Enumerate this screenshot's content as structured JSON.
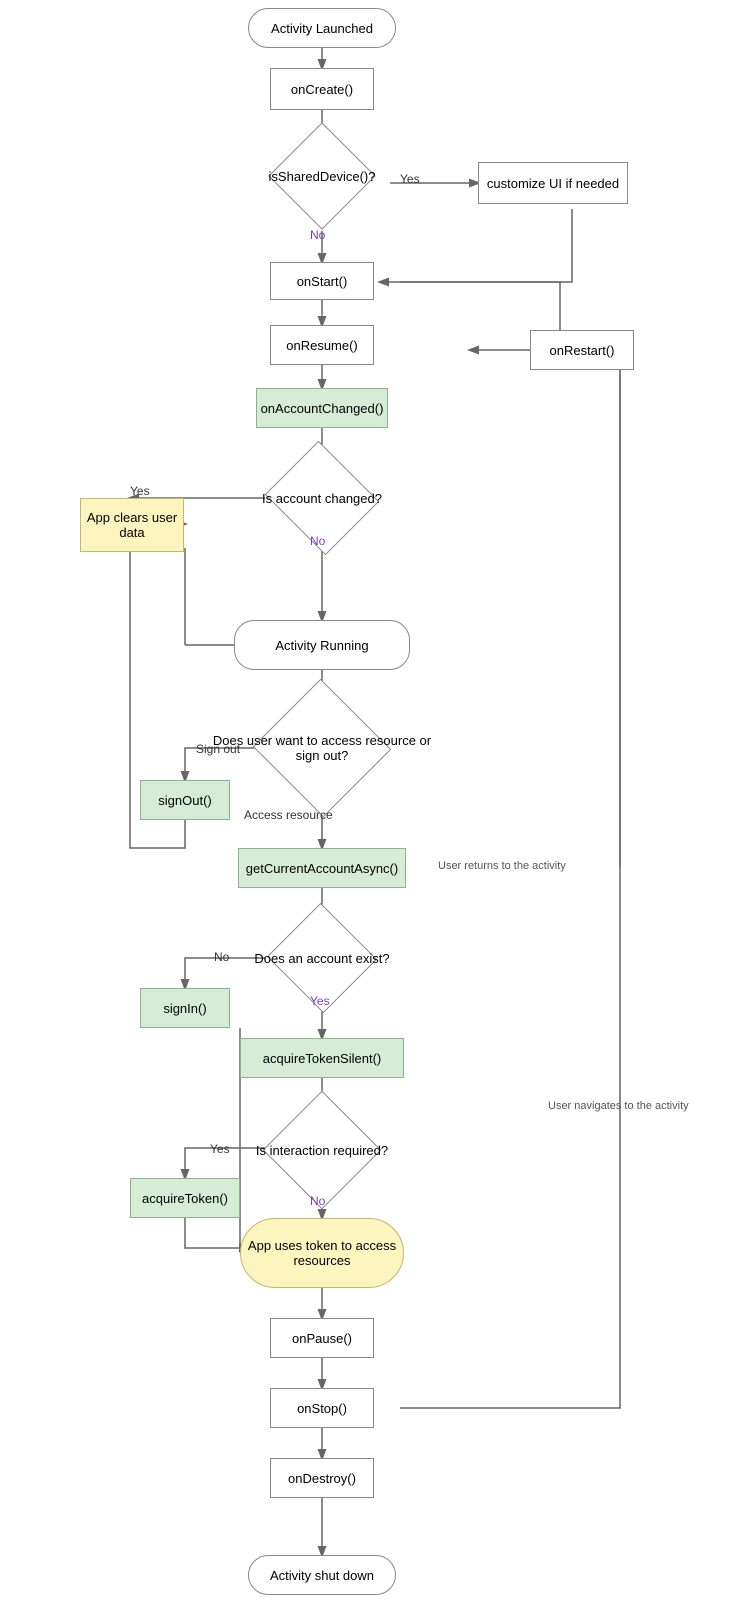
{
  "nodes": {
    "activity_launched": "Activity Launched",
    "onCreate": "onCreate()",
    "isSharedDevice": "isSharedDevice()?",
    "customize_ui": "customize UI if needed",
    "onStart": "onStart()",
    "onResume": "onResume()",
    "onRestart": "onRestart()",
    "onAccountChanged": "onAccountChanged()",
    "is_account_changed": "Is account changed?",
    "app_clears": "App clears user data",
    "activity_running": "Activity Running",
    "signOut": "signOut()",
    "does_user_want": "Does user want to access resource or sign out?",
    "getCurrentAccount": "getCurrentAccountAsync()",
    "does_account_exist": "Does an account exist?",
    "signIn": "signIn()",
    "acquireTokenSilent": "acquireTokenSilent()",
    "is_interaction_required": "Is interaction required?",
    "acquireToken": "acquireToken()",
    "app_uses_token": "App uses token to access resources",
    "onPause": "onPause()",
    "onStop": "onStop()",
    "onDestroy": "onDestroy()",
    "activity_shutdown": "Activity shut down"
  },
  "labels": {
    "yes": "Yes",
    "no": "No",
    "sign_out": "Sign out",
    "access_resource": "Access resource",
    "user_returns": "User returns to the activity",
    "user_navigates": "User navigates to the activity"
  }
}
